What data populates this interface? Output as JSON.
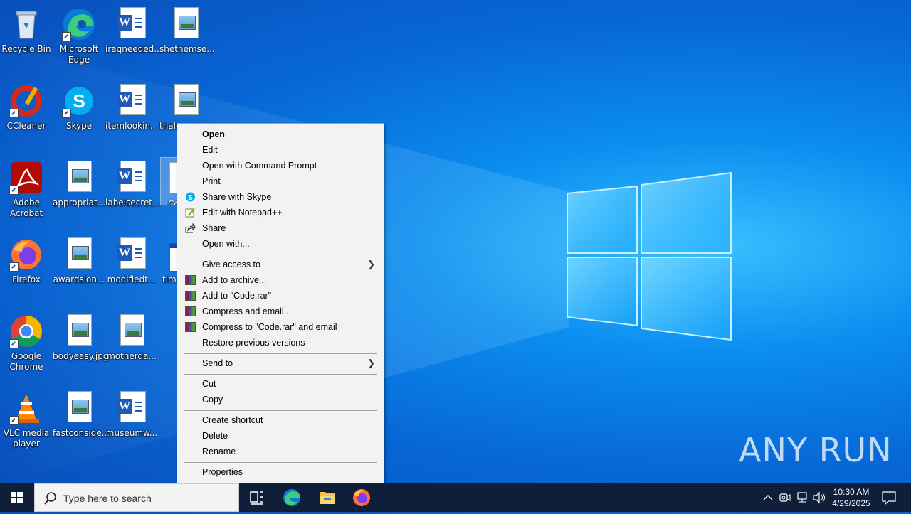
{
  "desktop": {
    "icons": [
      {
        "label": "Recycle Bin"
      },
      {
        "label": "Microsoft Edge"
      },
      {
        "label": "iraqneeded..."
      },
      {
        "label": "shethemse..."
      },
      {
        "label": "CCleaner"
      },
      {
        "label": "Skype"
      },
      {
        "label": "itemlookin..."
      },
      {
        "label": "thalenyn.jpg"
      },
      {
        "label": "Adobe Acrobat"
      },
      {
        "label": "appropriat..."
      },
      {
        "label": "labelsecret..."
      },
      {
        "label": "Co"
      },
      {
        "label": "Firefox"
      },
      {
        "label": "awardslon..."
      },
      {
        "label": "modifiedt..."
      },
      {
        "label": "tim"
      },
      {
        "label": "Google Chrome"
      },
      {
        "label": "bodyeasy.jpg"
      },
      {
        "label": "motherda..."
      },
      {
        "label": "VLC media player"
      },
      {
        "label": "fastconside..."
      },
      {
        "label": "museumw..."
      }
    ]
  },
  "context_menu": {
    "items": [
      {
        "label": "Open"
      },
      {
        "label": "Edit"
      },
      {
        "label": "Open with Command Prompt"
      },
      {
        "label": "Print"
      },
      {
        "label": "Share with Skype"
      },
      {
        "label": "Edit with Notepad++"
      },
      {
        "label": "Share"
      },
      {
        "label": "Open with..."
      },
      {
        "label": "Give access to"
      },
      {
        "label": "Add to archive..."
      },
      {
        "label": "Add to \"Code.rar\""
      },
      {
        "label": "Compress and email..."
      },
      {
        "label": "Compress to \"Code.rar\" and email"
      },
      {
        "label": "Restore previous versions"
      },
      {
        "label": "Send to"
      },
      {
        "label": "Cut"
      },
      {
        "label": "Copy"
      },
      {
        "label": "Create shortcut"
      },
      {
        "label": "Delete"
      },
      {
        "label": "Rename"
      },
      {
        "label": "Properties"
      }
    ]
  },
  "taskbar": {
    "search_placeholder": "Type here to search",
    "time": "10:30 AM",
    "date": "4/29/2025",
    "pinned": [
      "task-view-icon",
      "edge-icon",
      "file-explorer-icon",
      "firefox-icon"
    ]
  },
  "watermark": "ANY RUN",
  "colors": {
    "accent": "#0078d7",
    "taskbar": "#0f1f3a",
    "menu_bg": "#f2f2f2"
  }
}
